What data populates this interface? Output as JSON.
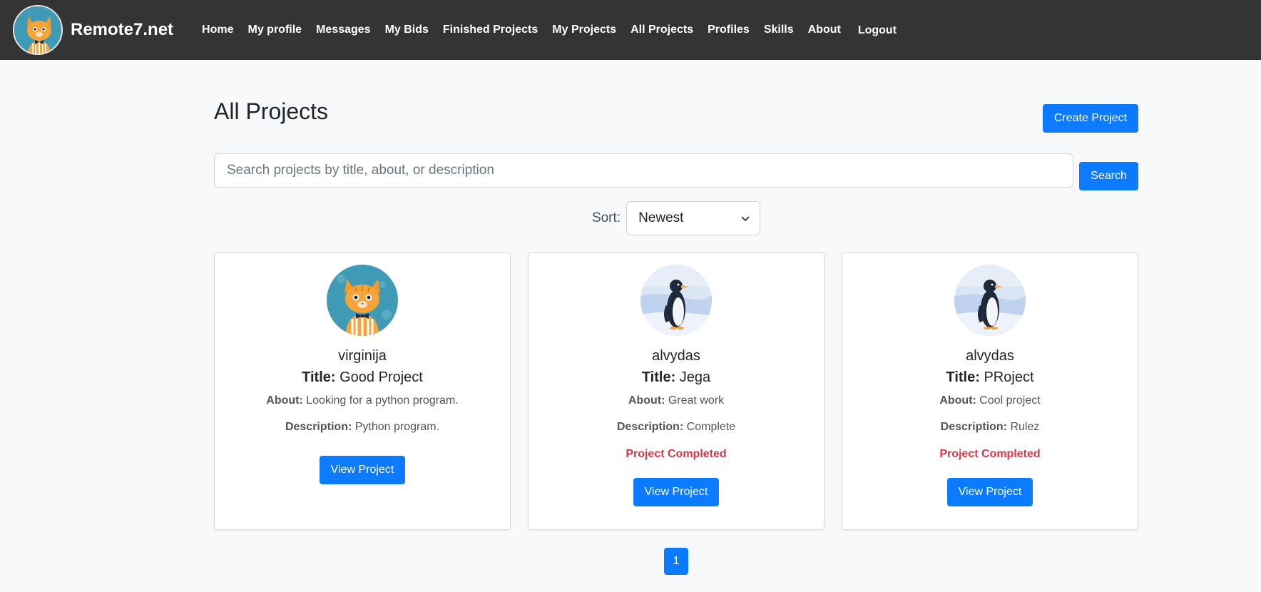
{
  "navbar": {
    "brand": "Remote7.net",
    "links": [
      "Home",
      "My profile",
      "Messages",
      "My Bids",
      "Finished Projects",
      "My Projects",
      "All Projects",
      "Profiles",
      "Skills",
      "About"
    ],
    "logout": "Logout"
  },
  "page": {
    "title": "All Projects",
    "create_button": "Create Project",
    "search_placeholder": "Search projects by title, about, or description",
    "search_button": "Search",
    "sort_label": "Sort:",
    "sort_value": "Newest"
  },
  "projects": [
    {
      "avatar_icon": "cat-avatar-icon",
      "username": "virginija",
      "title_label": "Title:",
      "title": "Good Project",
      "about_label": "About:",
      "about": "Looking for a python program.",
      "description_label": "Description:",
      "description": "Python program.",
      "status": "",
      "button": "View Project"
    },
    {
      "avatar_icon": "penguin-avatar-icon",
      "username": "alvydas",
      "title_label": "Title:",
      "title": "Jega",
      "about_label": "About:",
      "about": "Great work",
      "description_label": "Description:",
      "description": "Complete",
      "status": "Project Completed",
      "button": "View Project"
    },
    {
      "avatar_icon": "penguin-avatar-icon",
      "username": "alvydas",
      "title_label": "Title:",
      "title": "PRoject",
      "about_label": "About:",
      "about": "Cool project",
      "description_label": "Description:",
      "description": "Rulez",
      "status": "Project Completed",
      "button": "View Project"
    }
  ],
  "pagination": {
    "current_page": "1"
  },
  "colors": {
    "primary": "#0d7bff",
    "navbar": "#343434",
    "completed": "#dc3545",
    "background": "#f8f9fa"
  }
}
